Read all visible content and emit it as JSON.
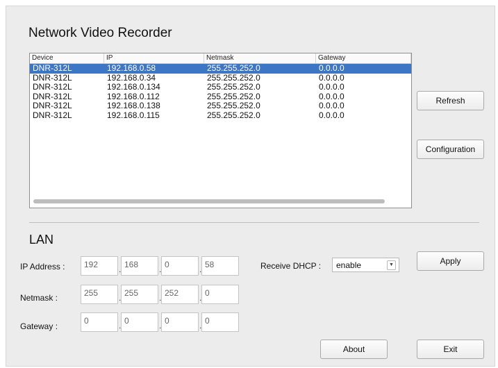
{
  "app": {
    "title": "Network Video Recorder"
  },
  "device_list": {
    "columns": [
      "Device",
      "IP",
      "Netmask",
      "Gateway"
    ],
    "rows": [
      [
        "DNR-312L",
        "192.168.0.58",
        "255.255.252.0",
        "0.0.0.0"
      ],
      [
        "DNR-312L",
        "192.168.0.34",
        "255.255.252.0",
        "0.0.0.0"
      ],
      [
        "DNR-312L",
        "192.168.0.134",
        "255.255.252.0",
        "0.0.0.0"
      ],
      [
        "DNR-312L",
        "192.168.0.112",
        "255.255.252.0",
        "0.0.0.0"
      ],
      [
        "DNR-312L",
        "192.168.0.138",
        "255.255.252.0",
        "0.0.0.0"
      ],
      [
        "DNR-312L",
        "192.168.0.115",
        "255.255.252.0",
        "0.0.0.0"
      ]
    ],
    "selected_row": 0
  },
  "buttons": {
    "refresh": "Refresh",
    "configuration": "Configuration",
    "apply": "Apply",
    "about": "About",
    "exit": "Exit"
  },
  "lan": {
    "title": "LAN",
    "ip_label": "IP Address :",
    "ip": [
      "192",
      "168",
      "0",
      "58"
    ],
    "netmask_label": "Netmask :",
    "netmask": [
      "255",
      "255",
      "252",
      "0"
    ],
    "gateway_label": "Gateway :",
    "gateway": [
      "0",
      "0",
      "0",
      "0"
    ],
    "dhcp_label": "Receive DHCP :",
    "dhcp_value": "enable"
  },
  "colors": {
    "selection": "#3e76c6",
    "window_bg": "#ececec"
  }
}
